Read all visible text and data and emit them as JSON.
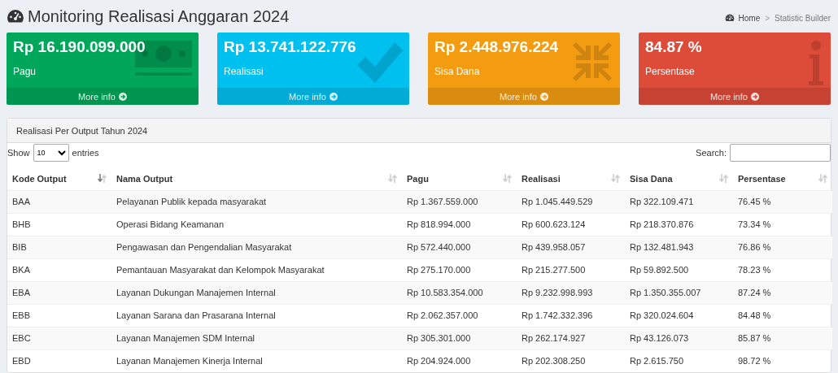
{
  "header": {
    "title": "Monitoring Realisasi Anggaran 2024",
    "breadcrumb": [
      {
        "label": "Home"
      },
      {
        "label": "Statistic Builder"
      }
    ],
    "breadcrumb_separator": ">"
  },
  "stat_boxes": [
    {
      "value": "Rp 16.190.099.000",
      "label": "Pagu",
      "link": "More info",
      "color": "#00a65a",
      "kind": "money"
    },
    {
      "value": "Rp 13.741.122.776",
      "label": "Realisasi",
      "link": "More info",
      "color": "#00c0ef",
      "kind": "check"
    },
    {
      "value": "Rp 2.448.976.224",
      "label": "Sisa Dana",
      "link": "More info",
      "color": "#f39c12",
      "kind": "compress"
    },
    {
      "value": "84.87 %",
      "label": "Persentase",
      "link": "More info",
      "color": "#dd4b39",
      "kind": "info"
    }
  ],
  "table_panel": {
    "title": "Realisasi Per Output Tahun 2024",
    "length_label_before": "Show",
    "length_value": "10",
    "length_label_after": "entries",
    "search_label": "Search:",
    "columns": [
      {
        "label": "Kode Output",
        "sorted": true
      },
      {
        "label": "Nama Output",
        "sorted": false
      },
      {
        "label": "Pagu",
        "sorted": false
      },
      {
        "label": "Realisasi",
        "sorted": false
      },
      {
        "label": "Sisa Dana",
        "sorted": false
      },
      {
        "label": "Persentase",
        "sorted": false
      }
    ],
    "rows": [
      [
        "BAA",
        "Pelayanan Publik kepada masyarakat",
        "Rp 1.367.559.000",
        "Rp 1.045.449.529",
        "Rp 322.109.471",
        "76.45 %"
      ],
      [
        "BHB",
        "Operasi Bidang Keamanan",
        "Rp 818.994.000",
        "Rp 600.623.124",
        "Rp 218.370.876",
        "73.34 %"
      ],
      [
        "BIB",
        "Pengawasan dan Pengendalian Masyarakat",
        "Rp 572.440.000",
        "Rp 439.958.057",
        "Rp 132.481.943",
        "76.86 %"
      ],
      [
        "BKA",
        "Pemantauan Masyarakat dan Kelompok Masyarakat",
        "Rp 275.170.000",
        "Rp 215.277.500",
        "Rp 59.892.500",
        "78.23 %"
      ],
      [
        "EBA",
        "Layanan Dukungan Manajemen Internal",
        "Rp 10.583.354.000",
        "Rp 9.232.998.993",
        "Rp 1.350.355.007",
        "87.24 %"
      ],
      [
        "EBB",
        "Layanan Sarana dan Prasarana Internal",
        "Rp 2.062.357.000",
        "Rp 1.742.332.396",
        "Rp 320.024.604",
        "84.48 %"
      ],
      [
        "EBC",
        "Layanan Manajemen SDM Internal",
        "Rp 305.301.000",
        "Rp 262.174.927",
        "Rp 43.126.073",
        "85.87 %"
      ],
      [
        "EBD",
        "Layanan Manajemen Kinerja Internal",
        "Rp 204.924.000",
        "Rp 202.308.250",
        "Rp 2.615.750",
        "98.72 %"
      ]
    ]
  }
}
